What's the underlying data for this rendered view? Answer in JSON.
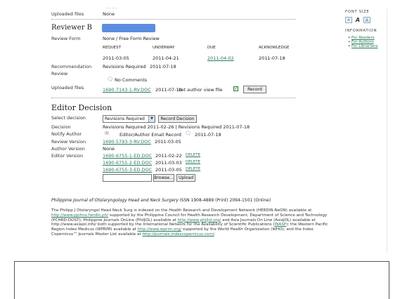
{
  "top_cut": "- - - -",
  "upload_section": {
    "label": "Uploaded files",
    "value": "None"
  },
  "reviewer": {
    "title": "Reviewer B",
    "review_form_label": "Review Form",
    "review_form_value": "None / Free Form Review",
    "columns": [
      "REQUEST",
      "UNDERWAY",
      "DUE",
      "ACKNOWLEDGE"
    ],
    "dates": [
      "2011-03-05",
      "2011-04-21",
      "2011-04-02",
      "2011-07-18"
    ],
    "recommendation_label": "Recommendation",
    "recommendation_value": "Revisions Required",
    "recommendation_date": "2011-07-18",
    "review_label": "Review",
    "review_value": "No Comments",
    "uploaded_label": "Uploaded files",
    "uploaded_file": "1690-7143-1-RV.DOC",
    "uploaded_date": "2011-07-18",
    "let_author_view": "Let author view file",
    "record_button": "Record"
  },
  "editor_decision": {
    "title": "Editor Decision",
    "select_decision_label": "Select decision",
    "select_decision_value": "Revisions Required",
    "record_decision_button": "Record Decision",
    "decision_label": "Decision",
    "decision_value": "Revisions Required  2011-02-26 | Revisions Required  2011-07-18",
    "notify_label": "Notify Author",
    "notify_value": "Editor/Author Email Record",
    "notify_date": "2011-07-18",
    "review_version_label": "Review Version",
    "review_version_file": "1690-5793-3-RV.DOC",
    "review_version_date": "2011-03-05",
    "author_version_label": "Author Version",
    "author_version_value": "None",
    "editor_version_label": "Editor Version",
    "editor_versions": [
      {
        "file": "1690-6755-1-ED.DOC",
        "date": "2011-02-22",
        "action": "DELETE"
      },
      {
        "file": "1690-6755-2-ED.DOC",
        "date": "2011-03-03",
        "action": "DELETE"
      },
      {
        "file": "1690-6755-3-ED.DOC",
        "date": "2011-03-05",
        "action": "DELETE"
      }
    ],
    "browse_button": "Browse...",
    "upload_button": "Upload"
  },
  "footer": {
    "journal_line": "Philippine Journal of Otolaryngology Head and Neck Surgery",
    "issn": "ISSN 1908-4889 (Print) 2094-1501 (Online)",
    "paragraph_parts": {
      "p1": "The Philipp J Otolaryngol Head Neck Surg is indexed on the Health Research and Development Network (HERDIN-NeON) available at ",
      "l1": "http://www.pjohns.herdin.ph/",
      "p2": " supported by the Philippine Council for Health Research Development, Department of Science and Technology (PCHRD-DOST); Philippine Journals OnLine (PhilJOL) available at ",
      "l2": "http://www.philjol.org/",
      "p3": " and Asia Journals On Line (AsiaJOL) available at http://www.asiajol.info/ both supported by the International Network for the Availability of Scientific Publications (",
      "l3": "INASP",
      "p4": "); the Western Pacific Region Index Medicus (WPRIM) available at ",
      "l4": "http://www.wprim.org/",
      "p5": " supported by the World Health Organization (WHO); and the Index Copernicus™ Journals Master List available at ",
      "l5": "http://journals.indexcopernicus.com/",
      "p6": "."
    }
  },
  "sidebar": {
    "font_size_title": "FONT SIZE",
    "font_buttons": [
      "A",
      "A",
      "A"
    ],
    "information_title": "INFORMATION",
    "links": [
      "For Readers",
      "For Authors",
      "For Librarians"
    ]
  },
  "colors": {
    "link": "#2a7a5a",
    "highlight": "#5b8ee0"
  }
}
